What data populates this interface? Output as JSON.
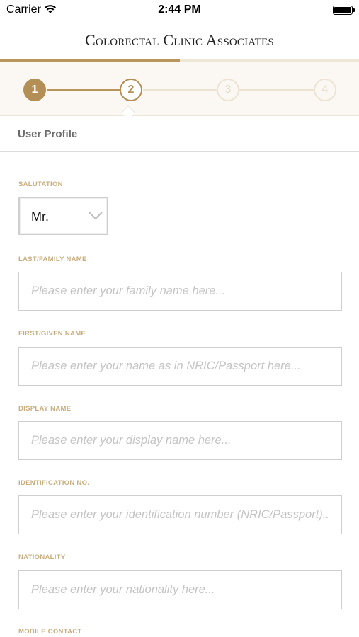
{
  "status_bar": {
    "carrier": "Carrier",
    "time": "2:44 PM"
  },
  "header": {
    "brand": "Colorectal Clinic Associates",
    "progress_fraction": 0.5
  },
  "stepper": {
    "steps": [
      "1",
      "2",
      "3",
      "4"
    ],
    "current_step": 2
  },
  "section": {
    "title": "User Profile"
  },
  "form": {
    "salutation": {
      "label": "SALUTATION",
      "value": "Mr."
    },
    "last_name": {
      "label": "LAST/FAMILY NAME",
      "placeholder": "Please enter your family name here..."
    },
    "first_name": {
      "label": "FIRST/GIVEN NAME",
      "placeholder": "Please enter your name as in NRIC/Passport here..."
    },
    "display_name": {
      "label": "DISPLAY NAME",
      "placeholder": "Please enter your display name here..."
    },
    "identification": {
      "label": "IDENTIFICATION NO.",
      "placeholder": "Please enter your identification number (NRIC/Passport)..."
    },
    "nationality": {
      "label": "NATIONALITY",
      "placeholder": "Please enter your nationality here..."
    },
    "mobile": {
      "label": "MOBILE CONTACT"
    }
  },
  "colors": {
    "accent": "#b38f55",
    "label": "#c9ad7d",
    "inactive": "#ece4d4"
  },
  "icons": {
    "wifi": "wifi-icon",
    "battery": "battery-icon",
    "dropdown": "chevron-down-icon"
  }
}
